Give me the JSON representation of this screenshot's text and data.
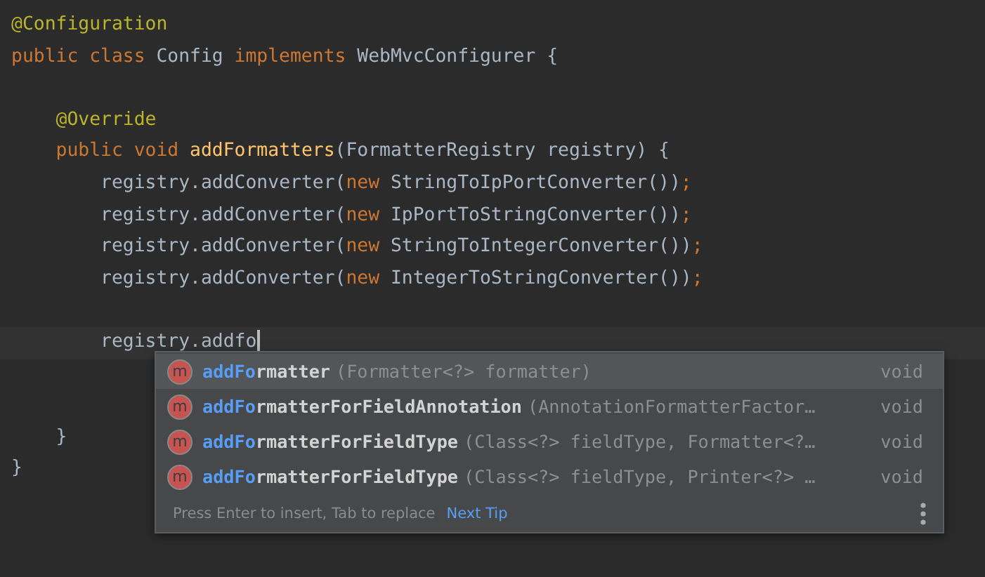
{
  "editor": {
    "lines": [
      {
        "current": false,
        "tokens": [
          {
            "kind": "annotation",
            "text": "@Configuration"
          }
        ]
      },
      {
        "current": false,
        "tokens": [
          {
            "kind": "keyword",
            "text": "public class "
          },
          {
            "kind": "plain",
            "text": "Config "
          },
          {
            "kind": "keyword",
            "text": "implements "
          },
          {
            "kind": "plain",
            "text": "WebMvcConfigurer {"
          }
        ]
      },
      {
        "current": false
      },
      {
        "current": false,
        "tokens": [
          {
            "kind": "annotation",
            "text": "    @Override"
          }
        ]
      },
      {
        "current": false,
        "tokens": [
          {
            "kind": "keyword",
            "text": "    public void "
          },
          {
            "kind": "declaration",
            "text": "addFormatters"
          },
          {
            "kind": "plain",
            "text": "(FormatterRegistry registry) {"
          }
        ]
      },
      {
        "current": false,
        "tokens": [
          {
            "kind": "plain",
            "text": "        registry.addConverter("
          },
          {
            "kind": "keyword",
            "text": "new "
          },
          {
            "kind": "plain",
            "text": "StringToIpPortConverter())"
          },
          {
            "kind": "keyword",
            "text": ";"
          }
        ]
      },
      {
        "current": false,
        "tokens": [
          {
            "kind": "plain",
            "text": "        registry.addConverter("
          },
          {
            "kind": "keyword",
            "text": "new "
          },
          {
            "kind": "plain",
            "text": "IpPortToStringConverter())"
          },
          {
            "kind": "keyword",
            "text": ";"
          }
        ]
      },
      {
        "current": false,
        "tokens": [
          {
            "kind": "plain",
            "text": "        registry.addConverter("
          },
          {
            "kind": "keyword",
            "text": "new "
          },
          {
            "kind": "plain",
            "text": "StringToIntegerConverter())"
          },
          {
            "kind": "keyword",
            "text": ";"
          }
        ]
      },
      {
        "current": false,
        "tokens": [
          {
            "kind": "plain",
            "text": "        registry.addConverter("
          },
          {
            "kind": "keyword",
            "text": "new "
          },
          {
            "kind": "plain",
            "text": "IntegerToStringConverter())"
          },
          {
            "kind": "keyword",
            "text": ";"
          }
        ]
      },
      {
        "current": false
      },
      {
        "current": true,
        "tokens": [
          {
            "kind": "plain",
            "text": "        registry.addfo"
          }
        ]
      },
      {
        "current": false
      },
      {
        "current": false
      },
      {
        "current": false,
        "tokens": [
          {
            "kind": "plain",
            "text": "    }"
          }
        ]
      },
      {
        "current": false,
        "tokens": [
          {
            "kind": "plain",
            "text": "}"
          }
        ]
      }
    ]
  },
  "completion": {
    "items": [
      {
        "selected": true,
        "icon": "m",
        "match": "addFo",
        "rest": "rmatter",
        "params": "(Formatter<?> formatter)",
        "type": "void"
      },
      {
        "selected": false,
        "icon": "m",
        "match": "addFo",
        "rest": "rmatterForFieldAnnotation",
        "params": "(AnnotationFormatterFactor…",
        "type": "void"
      },
      {
        "selected": false,
        "icon": "m",
        "match": "addFo",
        "rest": "rmatterForFieldType",
        "params": "(Class<?> fieldType, Formatter<?…",
        "type": "void"
      },
      {
        "selected": false,
        "icon": "m",
        "match": "addFo",
        "rest": "rmatterForFieldType",
        "params": "(Class<?> fieldType, Printer<?> …",
        "type": "void"
      }
    ],
    "hint": "Press Enter to insert, Tab to replace",
    "link": "Next Tip"
  }
}
